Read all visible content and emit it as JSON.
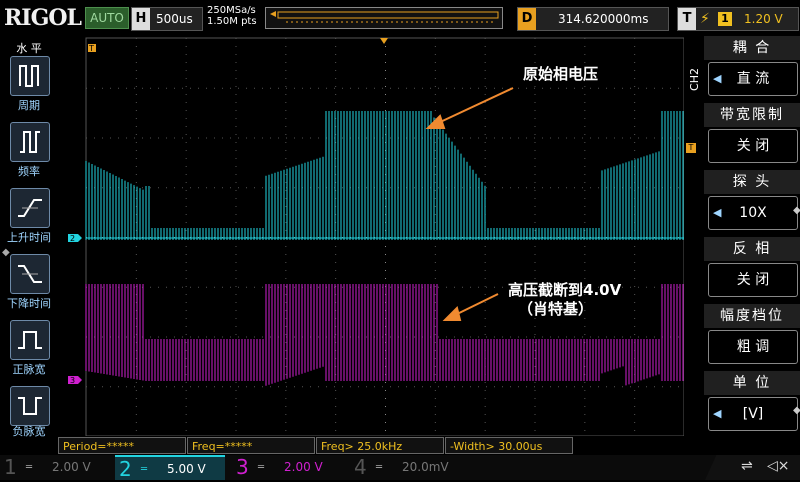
{
  "header": {
    "logo": "RIGOL",
    "run_mode": "AUTO",
    "timebase_key": "H",
    "timebase": "500us",
    "sample_rate": "250MSa/s",
    "memory_depth": "1.50M pts",
    "delay_key": "D",
    "delay": "314.620000ms",
    "trigger_key": "T",
    "trigger_source": "1",
    "trigger_level": "1.20 V"
  },
  "left_menu": {
    "title": "水 平",
    "items": [
      {
        "label": "周期",
        "icon": "period-icon"
      },
      {
        "label": "频率",
        "icon": "frequency-icon"
      },
      {
        "label": "上升时间",
        "icon": "rise-time-icon"
      },
      {
        "label": "下降时间",
        "icon": "fall-time-icon"
      },
      {
        "label": "正脉宽",
        "icon": "positive-width-icon"
      },
      {
        "label": "负脉宽",
        "icon": "negative-width-icon"
      }
    ]
  },
  "annotations": {
    "top": "原始相电压",
    "bottom_line1": "高压截断到4.0V",
    "bottom_line2": "（肖特基）"
  },
  "markers": {
    "trigger_marker": "T",
    "ch2_marker": "2",
    "ch3_marker": "3"
  },
  "right_menu": {
    "channel": "CH2",
    "items": [
      {
        "title": "耦 合",
        "value": "直 流",
        "arrow": true
      },
      {
        "title": "带宽限制",
        "value": "关 闭",
        "arrow": false
      },
      {
        "title": "探 头",
        "value": "10X",
        "arrow": true
      },
      {
        "title": "反 相",
        "value": "关 闭",
        "arrow": false
      },
      {
        "title": "幅度档位",
        "value": "粗 调",
        "arrow": false
      },
      {
        "title": "单 位",
        "value": "[V]",
        "arrow": true
      }
    ]
  },
  "measurements": [
    "Period=*****",
    "Freq=*****",
    "Freq> 25.0kHz",
    "-Width> 30.00us"
  ],
  "channels": [
    {
      "num": "1",
      "scale": "2.00 V",
      "active": false,
      "color": "#f0c020"
    },
    {
      "num": "2",
      "scale": "5.00 V",
      "active": true,
      "color": "#22d4e0"
    },
    {
      "num": "3",
      "scale": "2.00 V",
      "active": false,
      "color": "#d020d0"
    },
    {
      "num": "4",
      "scale": "20.0mV",
      "active": false,
      "color": "#2c7ad8"
    }
  ],
  "colors": {
    "ch2": "#22d4e0",
    "ch3": "#d020d0",
    "accent": "#e8a020",
    "annotation_arrow": "#f08a30"
  }
}
